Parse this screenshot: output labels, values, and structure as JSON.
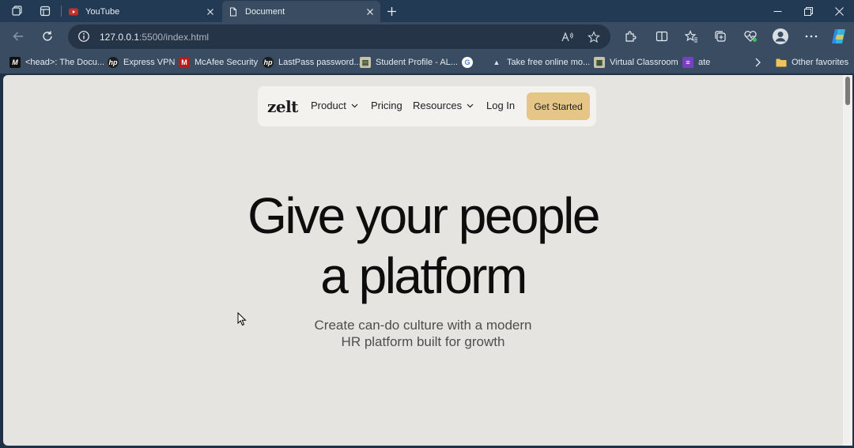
{
  "browser": {
    "tabs": [
      {
        "title": "YouTube",
        "favicon": "youtube-icon",
        "active": false
      },
      {
        "title": "Document",
        "favicon": "page-icon",
        "active": true
      }
    ],
    "address": {
      "host": "127.0.0.1",
      "path": ":5500/index.html"
    },
    "bookmarks": [
      {
        "label": "<head>: The Docu...",
        "icon": "mdn-icon"
      },
      {
        "label": "Express VPN",
        "icon": "hp-icon"
      },
      {
        "label": "McAfee Security",
        "icon": "mcafee-icon"
      },
      {
        "label": "LastPass password...",
        "icon": "hp-icon"
      },
      {
        "label": "Student Profile - AL...",
        "icon": "profile-icon"
      },
      {
        "label": "",
        "icon": "google-icon"
      },
      {
        "label": "Take free online mo...",
        "icon": "course-icon"
      },
      {
        "label": "Virtual Classroom",
        "icon": "classroom-icon"
      },
      {
        "label": "ate",
        "icon": "list-icon"
      }
    ],
    "other_favorites": "Other favorites"
  },
  "site": {
    "logo": "zelt",
    "nav": {
      "product": "Product",
      "pricing": "Pricing",
      "resources": "Resources",
      "login": "Log In",
      "cta": "Get Started"
    },
    "hero": {
      "line1": "Give your people",
      "line2": "a platform",
      "sub_line1": "Create can-do culture with a modern",
      "sub_line2": "HR platform built for growth"
    }
  },
  "colors": {
    "page_bg": "#e6e4e0",
    "cta_bg": "#e5c687",
    "browser_frame": "#3a4c61"
  }
}
